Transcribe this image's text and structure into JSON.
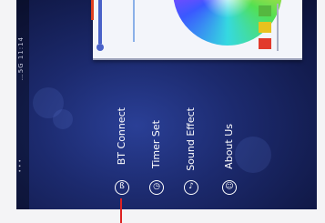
{
  "status_bar": {
    "top_text": "…5G  11:14",
    "bottom_text": "•  •  •"
  },
  "menu": {
    "items": [
      {
        "label": "BT Connect",
        "icon": "bluetooth-icon",
        "glyph": "ß"
      },
      {
        "label": "Timer Set",
        "icon": "timer-icon",
        "glyph": "◷"
      },
      {
        "label": "Sound Effect",
        "icon": "music-icon",
        "glyph": "♪"
      },
      {
        "label": "About Us",
        "icon": "person-icon",
        "glyph": "☺"
      }
    ]
  },
  "colors": {
    "accent": "#4a62c8",
    "swatch_green": "#55b83f",
    "swatch_yellow": "#e8c21e",
    "swatch_red": "#e23a2c"
  }
}
